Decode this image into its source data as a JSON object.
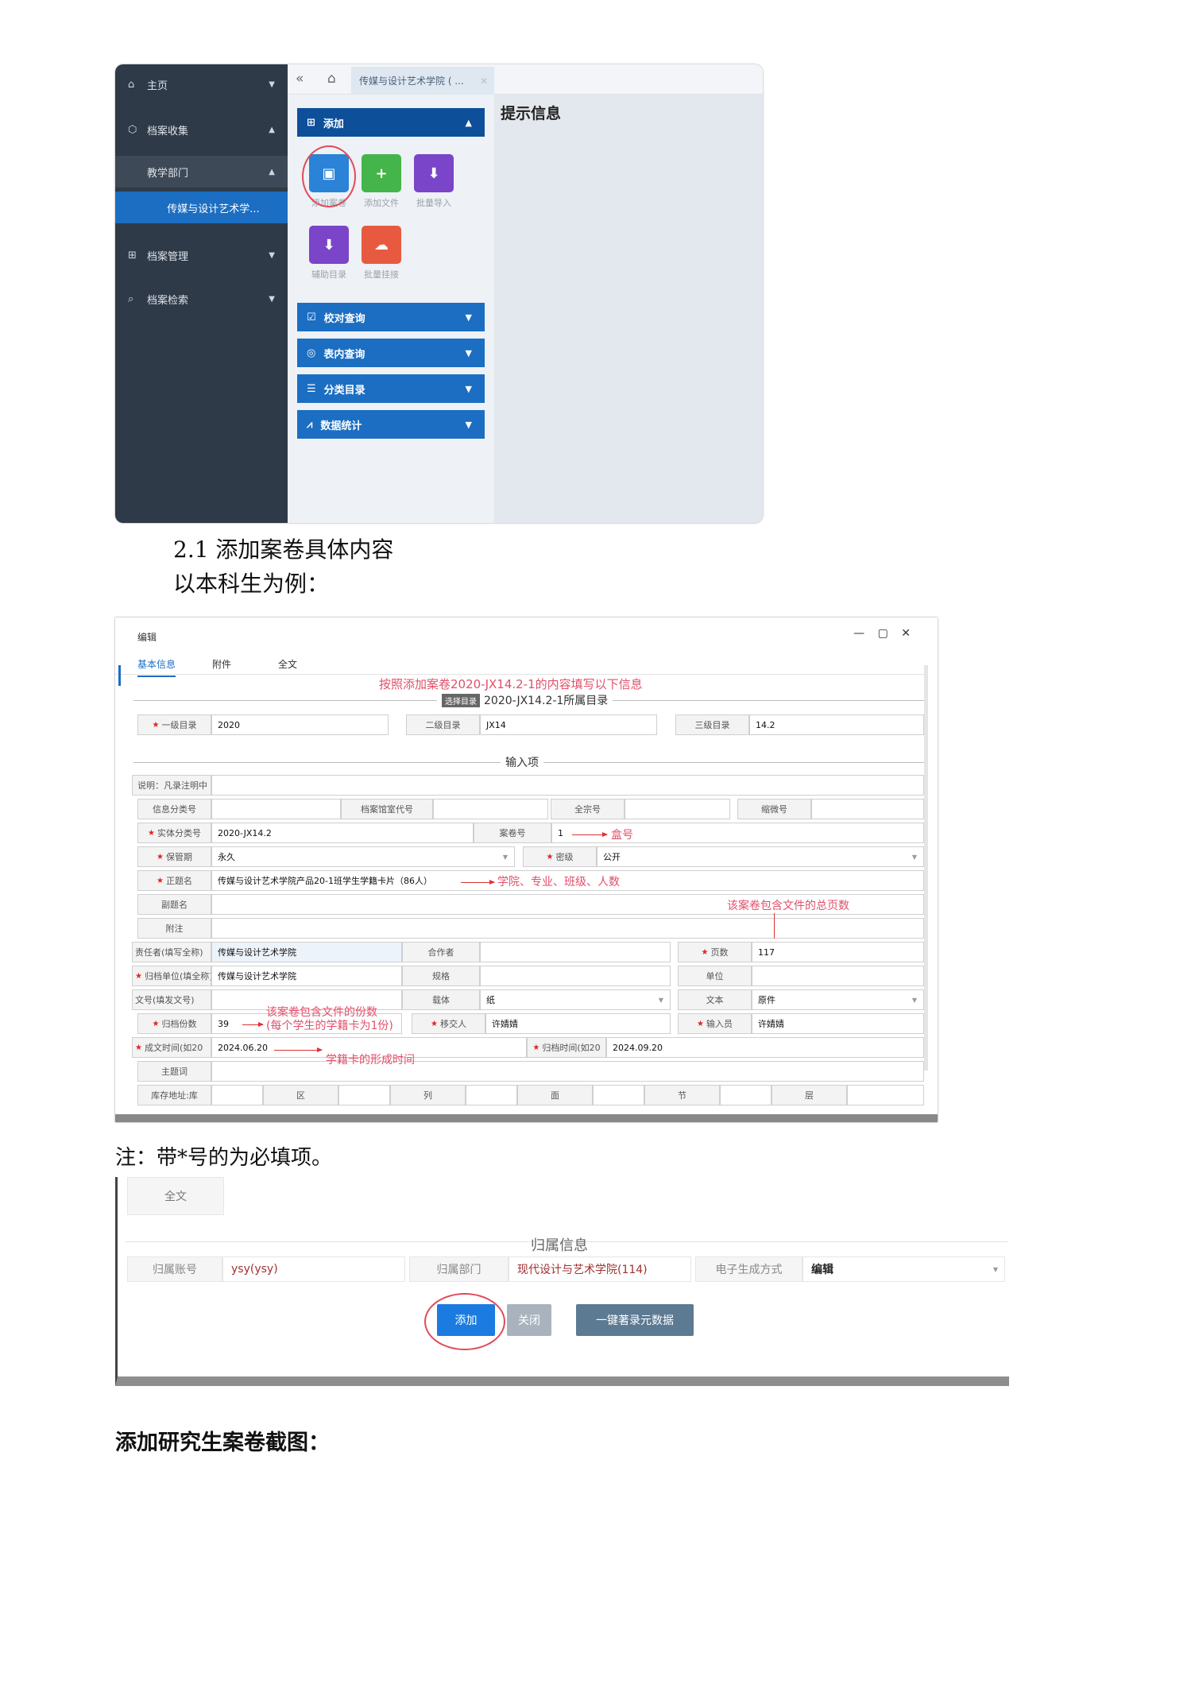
{
  "screenshot1": {
    "sidebar": [
      {
        "icon": "home-icon",
        "label": "主页"
      },
      {
        "icon": "box-icon",
        "label": "档案收集"
      },
      {
        "icon": "",
        "label": "教学部门"
      },
      {
        "icon": "",
        "label": "传媒与设计艺术学..."
      },
      {
        "icon": "grid-icon",
        "label": "档案管理"
      },
      {
        "icon": "search-icon",
        "label": "档案检索"
      }
    ],
    "tab_label": "传媒与设计艺术学院 ( ...",
    "hint_title": "提示信息",
    "add_header": "添加",
    "tiles": [
      {
        "label": "添加案卷",
        "color": "#2a83d6"
      },
      {
        "label": "添加文件",
        "color": "#44b54a"
      },
      {
        "label": "批量导入",
        "color": "#7a45c8"
      },
      {
        "label": "辅助目录",
        "color": "#7a45c8"
      },
      {
        "label": "批量挂接",
        "color": "#e85a40"
      }
    ],
    "accordions": [
      "校对查询",
      "表内查询",
      "分类目录",
      "数据统计"
    ]
  },
  "text": {
    "heading_2_1": "2.1 添加案卷具体内容",
    "example": "以本科生为例：",
    "note": "注：带*号的为必填项。",
    "grad_heading": "添加研究生案卷截图："
  },
  "screenshot2": {
    "window_title": "编辑",
    "window_buttons": "— ▢ ✕",
    "tabs": [
      "基本信息",
      "附件",
      "全文"
    ],
    "instruction": "按照添加案卷2020-JX14.2-1的内容填写以下信息",
    "select_badge": "选择目录",
    "catalog_title": "2020-JX14.2-1所属目录",
    "level1_label": "一级目录",
    "level1_value": "2020",
    "level2_label": "二级目录",
    "level2_value": "JX14",
    "level3_label": "三级目录",
    "level3_value": "14.2",
    "input_section": "输入项",
    "rows": {
      "r1_label": "说明：凡录注明中",
      "info_class_label": "信息分类号",
      "archive_code_label": "档案馆室代号",
      "fonds_label": "全宗号",
      "micro_label": "缩微号",
      "entity_label": "实体分类号",
      "entity_value": "2020-JX14.2",
      "volume_label": "案卷号",
      "volume_value": "1",
      "retention_label": "保管期",
      "retention_value": "永久",
      "secrecy_label": "密级",
      "secrecy_value": "公开",
      "title_label": "正题名",
      "title_value": "传媒与设计艺术学院产品20-1班学生学籍卡片（86人）",
      "subtitle_label": "副题名",
      "remark_label": "附注",
      "resp_label": "责任者(填写全称)",
      "resp_value": "传媒与设计艺术学院",
      "author_label": "合作者",
      "pages_label": "页数",
      "pages_value": "117",
      "archive_unit_label": "归档单位(填全称)",
      "archive_unit_value": "传媒与设计艺术学院",
      "spec_label": "规格",
      "unit_label": "单位",
      "docno_label": "文号(填发文号)",
      "carrier_label": "载体",
      "carrier_value": "纸",
      "version_label": "文本",
      "version_value": "原件",
      "copies_label": "归档份数",
      "copies_value": "39",
      "transfer_label": "移交人",
      "transfer_value": "许婧婧",
      "entry_label": "输入员",
      "entry_value": "许婧婧",
      "form_time_label": "成文时间(如20",
      "form_time_value": "2024.06.20",
      "archive_time_label": "归档时间(如20",
      "archive_time_value": "2024.09.20",
      "subject_label": "主题词",
      "storage_label": "库存地址:库",
      "storage_cols": [
        "区",
        "列",
        "面",
        "节",
        "层"
      ]
    },
    "annotations": {
      "box_no": "盒号",
      "title_note": "学院、专业、班级、人数",
      "pages_note": "该案卷包含文件的总页数",
      "copies_note1": "该案卷包含文件的份数",
      "copies_note2": "(每个学生的学籍卡为1份)",
      "time_note": "学籍卡的形成时间"
    }
  },
  "screenshot3": {
    "fulltext_label": "全文",
    "section_title": "归属信息",
    "account_label": "归属账号",
    "account_value": "ysy(ysy)",
    "dept_label": "归属部门",
    "dept_value": "现代设计与艺术学院(114)",
    "mode_label": "电子生成方式",
    "mode_value": "编辑",
    "buttons": [
      "添加",
      "关闭",
      "一键著录元数据"
    ],
    "colors": {
      "add": "#1b7be0",
      "close": "#a9b3bd",
      "meta": "#5d7a93"
    }
  }
}
